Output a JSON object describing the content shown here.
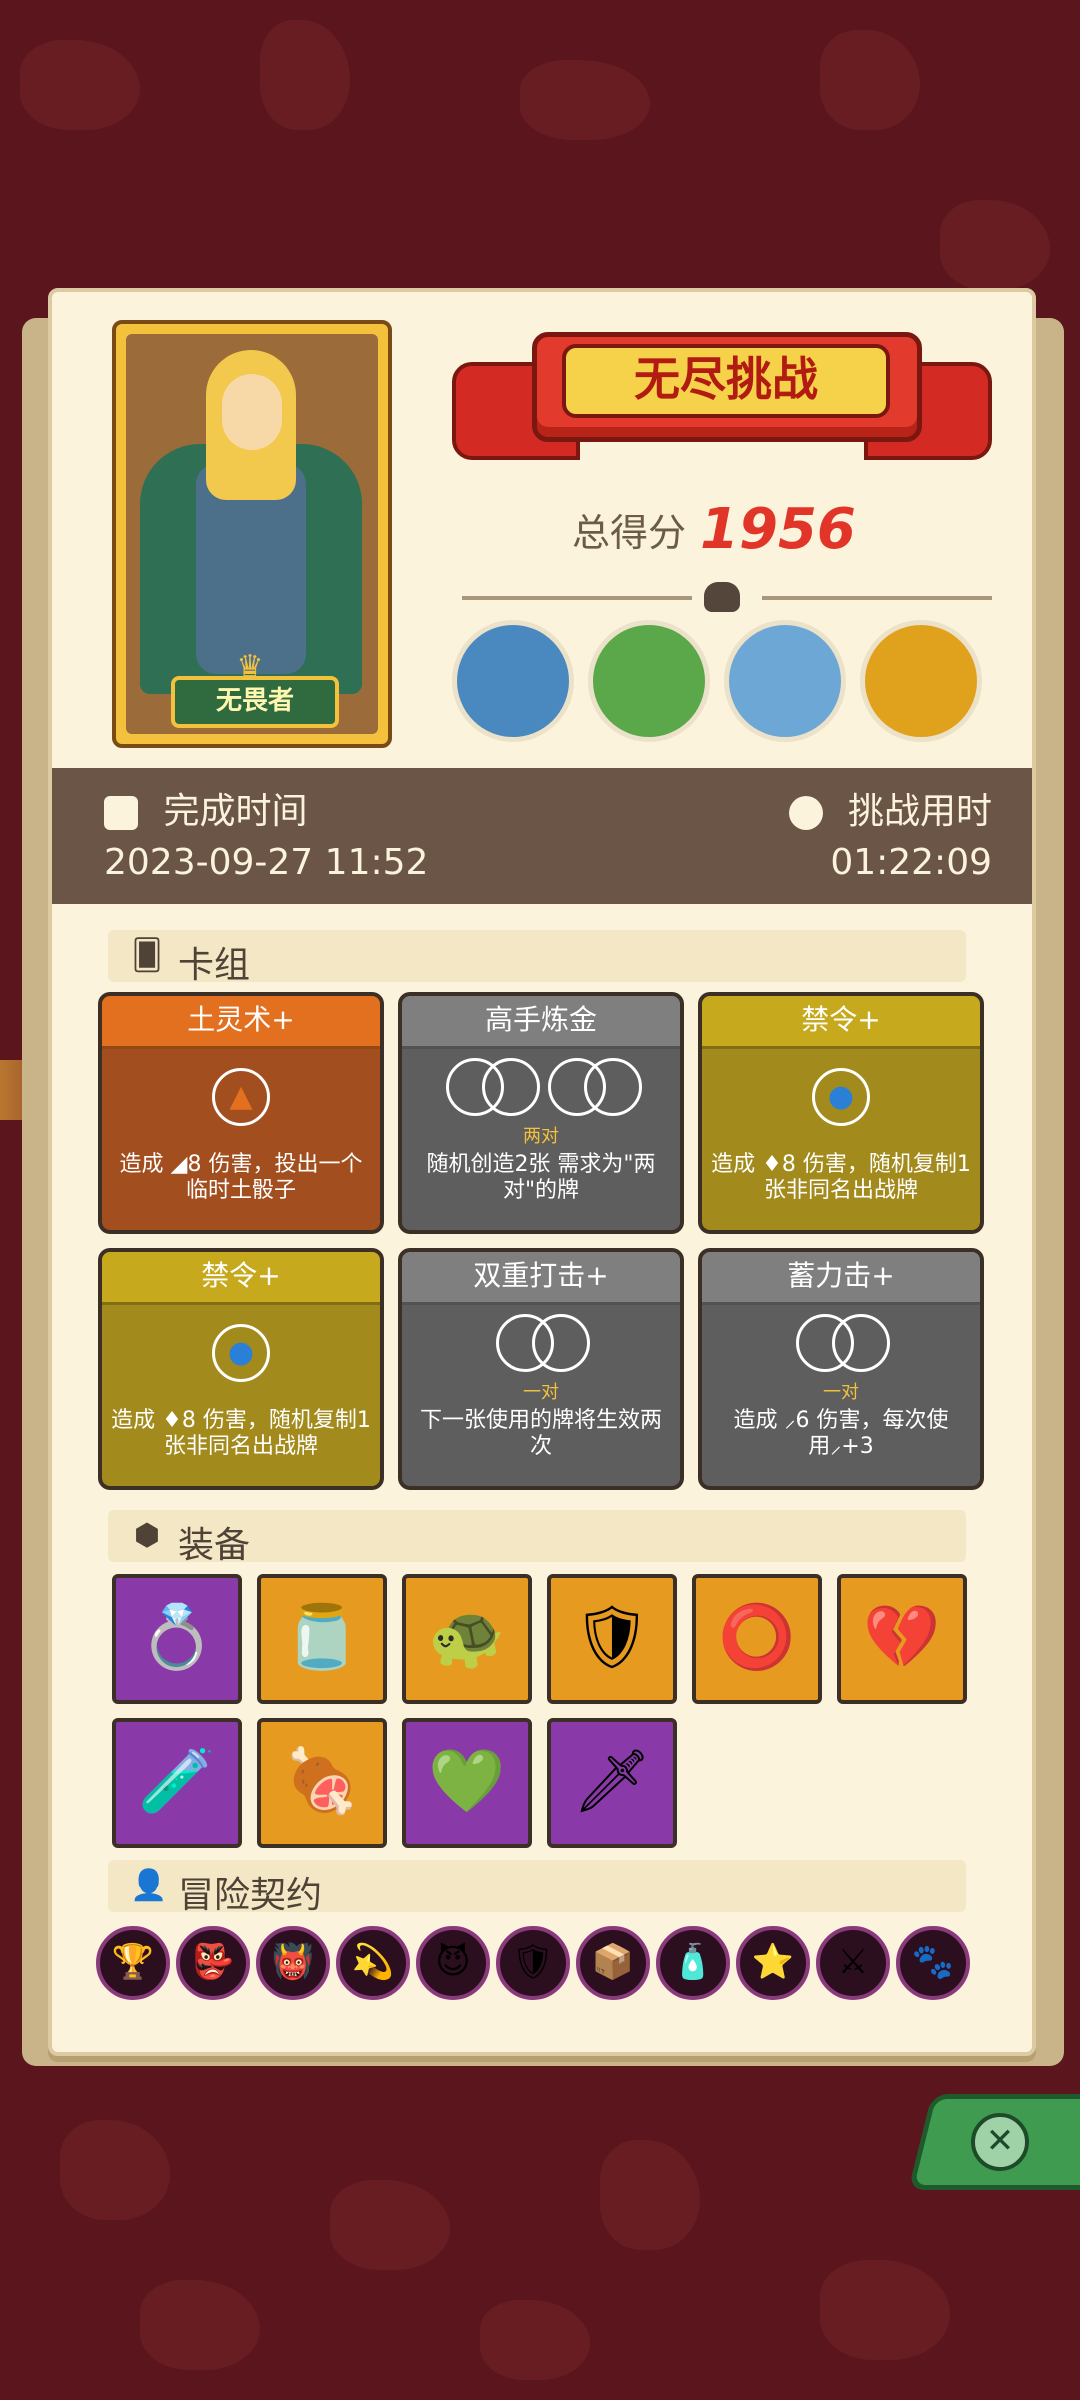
{
  "mode_title": "无尽挑战",
  "score": {
    "label": "总得分",
    "value": "1956"
  },
  "hero": {
    "name": "无畏者"
  },
  "bosses": [
    {
      "icon": "mushroom-elder-icon",
      "color": "#4a88c0"
    },
    {
      "icon": "goblin-icon",
      "color": "#5aa84a"
    },
    {
      "icon": "fur-hood-kid-icon",
      "color": "#6da7d6"
    },
    {
      "icon": "sunflower-pumpkin-icon",
      "color": "#e0a11c"
    }
  ],
  "time": {
    "finish_label": "完成时间",
    "finish_value": "2023-09-27 11:52",
    "duration_label": "挑战用时",
    "duration_value": "01:22:09"
  },
  "deck": {
    "label": "卡组",
    "cards": [
      {
        "name": "土灵术+",
        "color": "#a34e1f",
        "head": "#e2701e",
        "icon": "earth-orb-icon",
        "desc": "造成 ◢8 伤害，投出一个临时土骰子"
      },
      {
        "name": "高手炼金",
        "color": "#5e5e5e",
        "head": "#7f7f7f",
        "icon": "double-pair-rings-icon",
        "sub": "两对",
        "desc": "随机创造2张 需求为\"两对\"的牌"
      },
      {
        "name": "禁令+",
        "color": "#a38a1c",
        "head": "#c6a91c",
        "icon": "water-orb-icon",
        "desc": "造成 ♦8 伤害，随机复制1张非同名出战牌"
      },
      {
        "name": "禁令+",
        "color": "#a38a1c",
        "head": "#c6a91c",
        "icon": "water-orb-icon",
        "desc": "造成 ♦8 伤害，随机复制1张非同名出战牌"
      },
      {
        "name": "双重打击+",
        "color": "#5e5e5e",
        "head": "#7f7f7f",
        "icon": "pair-rings-icon",
        "sub": "一对",
        "desc": "下一张使用的牌将生效两次"
      },
      {
        "name": "蓄力击+",
        "color": "#5e5e5e",
        "head": "#7f7f7f",
        "icon": "pair-rings-icon",
        "sub": "一对",
        "desc": "造成 ⸝6 伤害，每次使用⸝+3"
      }
    ]
  },
  "equipment": {
    "label": "装备",
    "items": [
      {
        "icon": "diamond-ring-icon",
        "bg": "p",
        "glyph": "💍"
      },
      {
        "icon": "jar-icon",
        "bg": "o",
        "glyph": "🫙"
      },
      {
        "icon": "turtle-shell-icon",
        "bg": "o",
        "glyph": "🐢"
      },
      {
        "icon": "spiked-armor-icon",
        "bg": "o",
        "glyph": "🛡"
      },
      {
        "icon": "donut-amulet-icon",
        "bg": "o",
        "glyph": "⭕"
      },
      {
        "icon": "cracked-heart-icon",
        "bg": "o",
        "glyph": "💔"
      },
      {
        "icon": "wineskin-icon",
        "bg": "p",
        "glyph": "🧪"
      },
      {
        "icon": "meat-leg-icon",
        "bg": "o",
        "glyph": "🍖"
      },
      {
        "icon": "gem-ring-icon",
        "bg": "p",
        "glyph": "💚"
      },
      {
        "icon": "crystal-dagger-icon",
        "bg": "p",
        "glyph": "🗡"
      }
    ]
  },
  "contracts": {
    "label": "冒险契约",
    "items": [
      {
        "icon": "chalice-icon",
        "glyph": "🏆"
      },
      {
        "icon": "goblin-head-icon",
        "glyph": "👺"
      },
      {
        "icon": "demon-face-icon",
        "glyph": "👹"
      },
      {
        "icon": "golden-halo-icon",
        "glyph": "💫"
      },
      {
        "icon": "spiky-beast-icon",
        "glyph": "😈"
      },
      {
        "icon": "blue-shield-icon",
        "glyph": "🛡"
      },
      {
        "icon": "crate-icon",
        "glyph": "📦"
      },
      {
        "icon": "potion-icon",
        "glyph": "🧴"
      },
      {
        "icon": "star-triangle-icon",
        "glyph": "⭐"
      },
      {
        "icon": "sword-shield-icon",
        "glyph": "⚔"
      },
      {
        "icon": "paw-shield-icon",
        "glyph": "🐾"
      }
    ]
  }
}
